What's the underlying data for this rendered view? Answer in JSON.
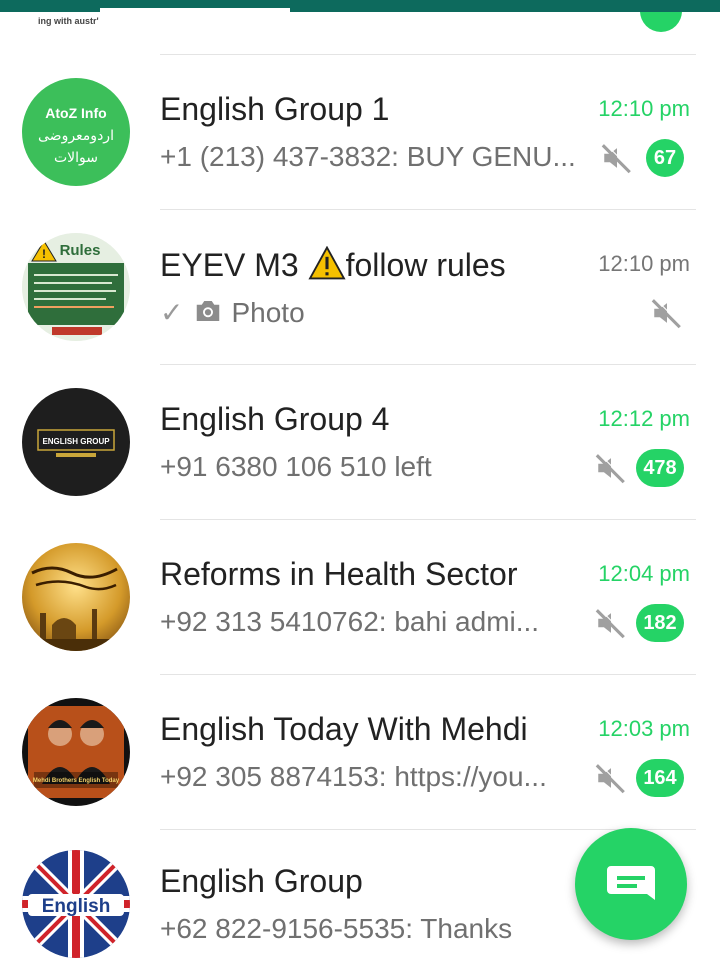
{
  "partial_row": {
    "avatar_text": "ing with austr'"
  },
  "chats": [
    {
      "name": "English Group 1",
      "time": "12:10 pm",
      "preview": "+1 (213) 437-3832: BUY GENU...",
      "unread": "67",
      "muted": true,
      "avatar": {
        "type": "text-green",
        "line1": "AtoZ Info",
        "line2": "اردومعروضی",
        "line3": "سوالات",
        "bg": "#3cbf5a"
      }
    },
    {
      "name": "EYEV M3 ",
      "name_warning_icon": "warning-icon",
      "name_suffix": "follow rules",
      "time": "12:10 pm",
      "preview": "Photo",
      "read_check": "✓",
      "muted": true,
      "avatar": {
        "type": "rules",
        "title": "Rules"
      }
    },
    {
      "name": "English Group 4",
      "time": "12:12 pm",
      "preview": "+91 6380 106 510 left",
      "unread": "478",
      "muted": true,
      "avatar": {
        "type": "dark",
        "label": "ENGLISH GROUP",
        "bg": "#1e1e1e"
      }
    },
    {
      "name": "Reforms in Health Sector",
      "time": "12:04 pm",
      "preview": "+92 313 5410762: bahi admi...",
      "unread": "182",
      "muted": true,
      "avatar": {
        "type": "mosque",
        "bg": "#c89a2c"
      }
    },
    {
      "name": "English Today With Mehdi",
      "time": "12:03 pm",
      "preview": "+92 305 8874153: https://you...",
      "unread": "164",
      "muted": true,
      "avatar": {
        "type": "people",
        "caption": "Mehdi Brothers English Today",
        "bg": "#b8501a"
      }
    },
    {
      "name": "English Group",
      "time": "",
      "preview": "+62 822-9156-5535: Thanks",
      "unread": "",
      "muted": true,
      "avatar": {
        "type": "flag",
        "label": "English"
      }
    }
  ],
  "fab": {
    "icon": "new-chat-icon"
  },
  "colors": {
    "accent": "#25d366",
    "header": "#0d6a5d",
    "muted_icon": "#a0a0a0"
  }
}
